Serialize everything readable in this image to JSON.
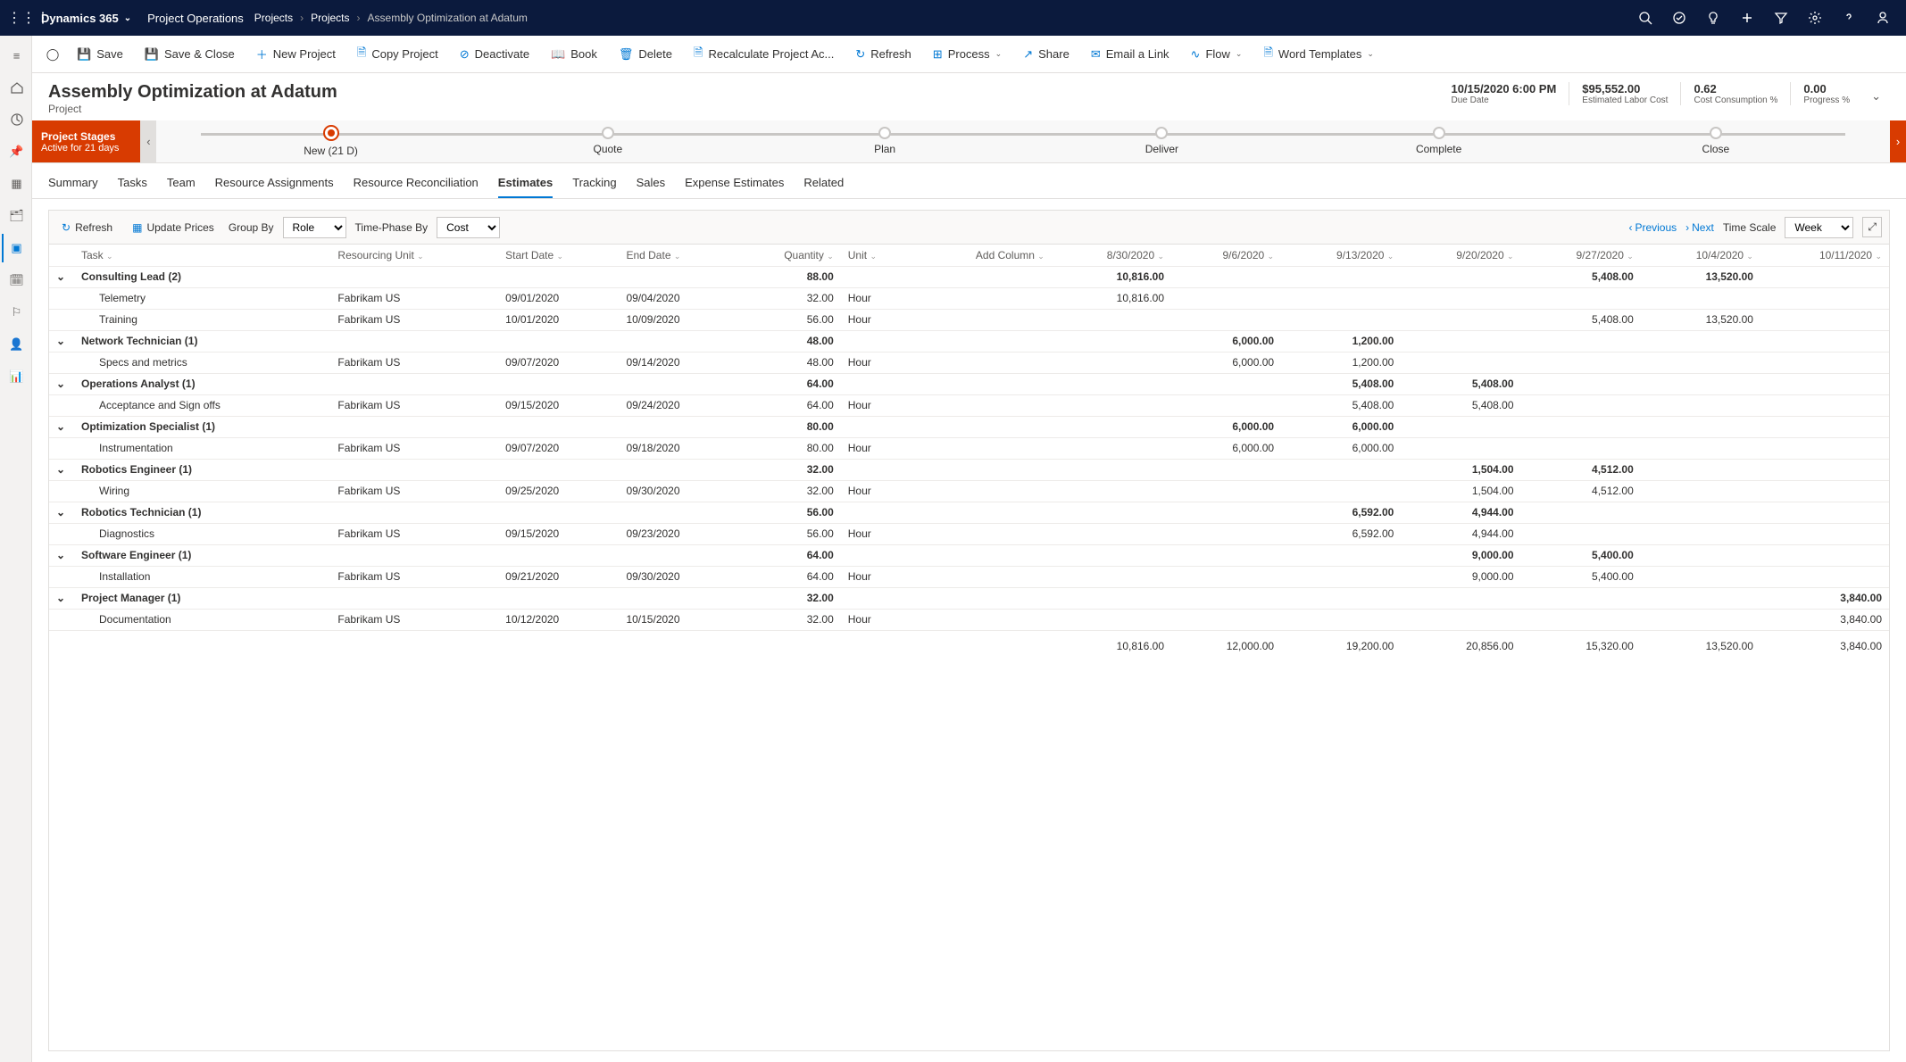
{
  "topbar": {
    "brand": "Dynamics 365",
    "module": "Project Operations",
    "crumbs": [
      "Projects",
      "Projects",
      "Assembly Optimization at Adatum"
    ]
  },
  "commands": {
    "save": "Save",
    "saveclose": "Save & Close",
    "new": "New Project",
    "copy": "Copy Project",
    "deactivate": "Deactivate",
    "book": "Book",
    "delete": "Delete",
    "recalc": "Recalculate Project Ac...",
    "refresh": "Refresh",
    "process": "Process",
    "share": "Share",
    "email": "Email a Link",
    "flow": "Flow",
    "word": "Word Templates"
  },
  "header": {
    "title": "Assembly Optimization at Adatum",
    "subtitle": "Project",
    "metrics": [
      {
        "v": "10/15/2020 6:00 PM",
        "l": "Due Date"
      },
      {
        "v": "$95,552.00",
        "l": "Estimated Labor Cost"
      },
      {
        "v": "0.62",
        "l": "Cost Consumption %"
      },
      {
        "v": "0.00",
        "l": "Progress %"
      }
    ]
  },
  "stagesLabel": {
    "title": "Project Stages",
    "sub": "Active for 21 days"
  },
  "stages": [
    {
      "label": "New  (21 D)",
      "active": true
    },
    {
      "label": "Quote"
    },
    {
      "label": "Plan"
    },
    {
      "label": "Deliver"
    },
    {
      "label": "Complete"
    },
    {
      "label": "Close"
    }
  ],
  "tabs": [
    "Summary",
    "Tasks",
    "Team",
    "Resource Assignments",
    "Resource Reconciliation",
    "Estimates",
    "Tracking",
    "Sales",
    "Expense Estimates",
    "Related"
  ],
  "activeTab": "Estimates",
  "toolbar2": {
    "refresh": "Refresh",
    "update": "Update Prices",
    "groupby": "Group By",
    "groupbyVal": "Role",
    "timephase": "Time-Phase By",
    "timephaseVal": "Cost",
    "prev": "Previous",
    "next": "Next",
    "timescale": "Time Scale",
    "timescaleVal": "Week"
  },
  "columns": [
    "Task",
    "Resourcing Unit",
    "Start Date",
    "End Date",
    "Quantity",
    "Unit",
    "Add Column",
    "8/30/2020",
    "9/6/2020",
    "9/13/2020",
    "9/20/2020",
    "9/27/2020",
    "10/4/2020",
    "10/11/2020"
  ],
  "dateStart": 7,
  "groups": [
    {
      "name": "Consulting Lead (2)",
      "qty": "88.00",
      "vals": {
        "8/30/2020": "10,816.00",
        "9/27/2020": "5,408.00",
        "10/4/2020": "13,520.00"
      },
      "rows": [
        {
          "task": "Telemetry",
          "unitOrg": "Fabrikam US",
          "start": "09/01/2020",
          "end": "09/04/2020",
          "qty": "32.00",
          "unit": "Hour",
          "vals": {
            "8/30/2020": "10,816.00"
          }
        },
        {
          "task": "Training",
          "unitOrg": "Fabrikam US",
          "start": "10/01/2020",
          "end": "10/09/2020",
          "qty": "56.00",
          "unit": "Hour",
          "vals": {
            "9/27/2020": "5,408.00",
            "10/4/2020": "13,520.00"
          }
        }
      ]
    },
    {
      "name": "Network Technician (1)",
      "qty": "48.00",
      "vals": {
        "9/6/2020": "6,000.00",
        "9/13/2020": "1,200.00"
      },
      "rows": [
        {
          "task": "Specs and metrics",
          "unitOrg": "Fabrikam US",
          "start": "09/07/2020",
          "end": "09/14/2020",
          "qty": "48.00",
          "unit": "Hour",
          "vals": {
            "9/6/2020": "6,000.00",
            "9/13/2020": "1,200.00"
          }
        }
      ]
    },
    {
      "name": "Operations Analyst (1)",
      "qty": "64.00",
      "vals": {
        "9/13/2020": "5,408.00",
        "9/20/2020": "5,408.00"
      },
      "rows": [
        {
          "task": "Acceptance and Sign offs",
          "unitOrg": "Fabrikam US",
          "start": "09/15/2020",
          "end": "09/24/2020",
          "qty": "64.00",
          "unit": "Hour",
          "vals": {
            "9/13/2020": "5,408.00",
            "9/20/2020": "5,408.00"
          }
        }
      ]
    },
    {
      "name": "Optimization Specialist (1)",
      "qty": "80.00",
      "vals": {
        "9/6/2020": "6,000.00",
        "9/13/2020": "6,000.00"
      },
      "rows": [
        {
          "task": "Instrumentation",
          "unitOrg": "Fabrikam US",
          "start": "09/07/2020",
          "end": "09/18/2020",
          "qty": "80.00",
          "unit": "Hour",
          "vals": {
            "9/6/2020": "6,000.00",
            "9/13/2020": "6,000.00"
          }
        }
      ]
    },
    {
      "name": "Robotics Engineer (1)",
      "qty": "32.00",
      "vals": {
        "9/20/2020": "1,504.00",
        "9/27/2020": "4,512.00"
      },
      "rows": [
        {
          "task": "Wiring",
          "unitOrg": "Fabrikam US",
          "start": "09/25/2020",
          "end": "09/30/2020",
          "qty": "32.00",
          "unit": "Hour",
          "vals": {
            "9/20/2020": "1,504.00",
            "9/27/2020": "4,512.00"
          }
        }
      ]
    },
    {
      "name": "Robotics Technician (1)",
      "qty": "56.00",
      "vals": {
        "9/13/2020": "6,592.00",
        "9/20/2020": "4,944.00"
      },
      "rows": [
        {
          "task": "Diagnostics",
          "unitOrg": "Fabrikam US",
          "start": "09/15/2020",
          "end": "09/23/2020",
          "qty": "56.00",
          "unit": "Hour",
          "vals": {
            "9/13/2020": "6,592.00",
            "9/20/2020": "4,944.00"
          }
        }
      ]
    },
    {
      "name": "Software Engineer (1)",
      "qty": "64.00",
      "vals": {
        "9/20/2020": "9,000.00",
        "9/27/2020": "5,400.00"
      },
      "rows": [
        {
          "task": "Installation",
          "unitOrg": "Fabrikam US",
          "start": "09/21/2020",
          "end": "09/30/2020",
          "qty": "64.00",
          "unit": "Hour",
          "vals": {
            "9/20/2020": "9,000.00",
            "9/27/2020": "5,400.00"
          }
        }
      ]
    },
    {
      "name": "Project Manager (1)",
      "qty": "32.00",
      "vals": {
        "10/11/2020": "3,840.00"
      },
      "rows": [
        {
          "task": "Documentation",
          "unitOrg": "Fabrikam US",
          "start": "10/12/2020",
          "end": "10/15/2020",
          "qty": "32.00",
          "unit": "Hour",
          "vals": {
            "10/11/2020": "3,840.00"
          }
        }
      ]
    }
  ],
  "footer": {
    "8/30/2020": "10,816.00",
    "9/6/2020": "12,000.00",
    "9/13/2020": "19,200.00",
    "9/20/2020": "20,856.00",
    "9/27/2020": "15,320.00",
    "10/4/2020": "13,520.00",
    "10/11/2020": "3,840.00"
  }
}
